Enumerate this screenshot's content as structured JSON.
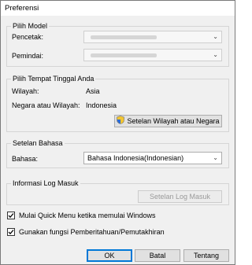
{
  "window": {
    "title": "Preferensi"
  },
  "model": {
    "legend": "Pilih Model",
    "printer_label": "Pencetak:",
    "scanner_label": "Pemindai:"
  },
  "location": {
    "legend": "Pilih Tempat Tinggal Anda",
    "region_label": "Wilayah:",
    "region_value": "Asia",
    "country_label": "Negara atau Wilayah:",
    "country_value": "Indonesia",
    "button_label": "Setelan Wilayah atau Negara"
  },
  "language": {
    "legend": "Setelan Bahasa",
    "label": "Bahasa:",
    "selected": "Bahasa Indonesia(Indonesian)"
  },
  "login_log": {
    "legend": "Informasi Log Masuk",
    "button_label": "Setelan Log Masuk"
  },
  "options": {
    "quick_menu_label": "Mulai Quick Menu ketika memulai Windows",
    "quick_menu_checked": true,
    "notify_label": "Gunakan fungsi Pemberitahuan/Pemutakhiran",
    "notify_checked": true
  },
  "footer": {
    "ok": "OK",
    "cancel": "Batal",
    "about": "Tentang"
  },
  "colors": {
    "accent": "#0078d7",
    "dialog_bg": "#f0f0f0"
  }
}
